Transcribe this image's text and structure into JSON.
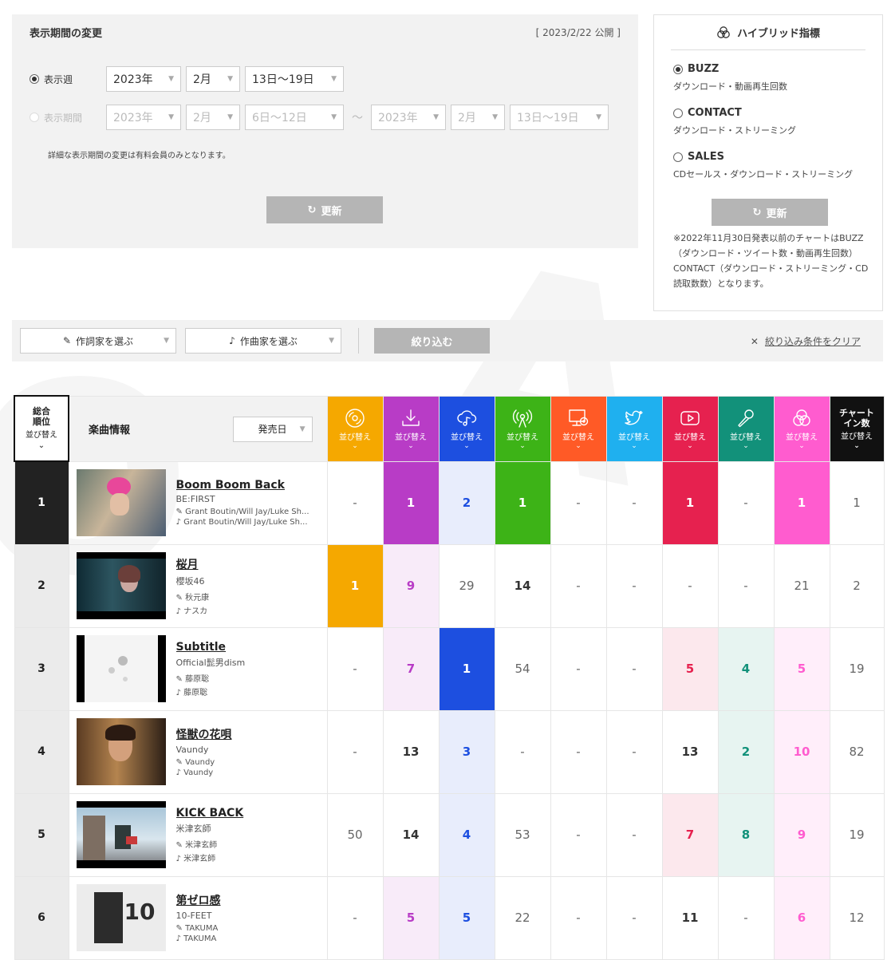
{
  "period": {
    "title": "表示期間の変更",
    "published": "[ 2023/2/22 公開 ]",
    "week_label": "表示週",
    "week": {
      "year": "2023年",
      "month": "2月",
      "days": "13日〜19日"
    },
    "range_label": "表示期間",
    "range_from": {
      "year": "2023年",
      "month": "2月",
      "days": "6日〜12日"
    },
    "range_sep": "〜",
    "range_to": {
      "year": "2023年",
      "month": "2月",
      "days": "13日〜19日"
    },
    "note": "詳細な表示期間の変更は有料会員のみとなります。",
    "update": "更新"
  },
  "hybrid": {
    "title": "ハイブリッド指標",
    "options": [
      {
        "name": "BUZZ",
        "desc": "ダウンロード・動画再生回数",
        "selected": true
      },
      {
        "name": "CONTACT",
        "desc": "ダウンロード・ストリーミング",
        "selected": false
      },
      {
        "name": "SALES",
        "desc": "CDセールス・ダウンロード・ストリーミング",
        "selected": false
      }
    ],
    "update": "更新",
    "note": "※2022年11月30日発表以前のチャートはBUZZ（ダウンロード・ツイート数・動画再生回数）CONTACT（ダウンロード・ストリーミング・CD読取数数）となります。"
  },
  "filter": {
    "lyricist": "作詞家を選ぶ",
    "composer": "作曲家を選ぶ",
    "apply": "絞り込む",
    "clear": "絞り込み条件をクリア"
  },
  "table": {
    "rank_header": [
      "総合",
      "順位"
    ],
    "sort": "並び替え",
    "song_header": "楽曲情報",
    "date_select": "発売日",
    "chart_in_header": [
      "チャート",
      "イン数"
    ],
    "metric_columns": [
      {
        "icon": "cd-icon",
        "color": "#f5a800"
      },
      {
        "icon": "download-icon",
        "color": "#b83cc6"
      },
      {
        "icon": "streaming-icon",
        "color": "#1d4fe0"
      },
      {
        "icon": "radio-icon",
        "color": "#3db317"
      },
      {
        "icon": "pc-read-icon",
        "color": "#ff5a26"
      },
      {
        "icon": "twitter-icon",
        "color": "#1fb0ef"
      },
      {
        "icon": "youtube-icon",
        "color": "#e6214f"
      },
      {
        "icon": "karaoke-icon",
        "color": "#12917a"
      },
      {
        "icon": "hybrid-icon",
        "color": "#ff5ccf"
      }
    ],
    "rows": [
      {
        "rank": "1",
        "title": "Boom Boom Back",
        "artist": "BE:FIRST",
        "lyricist": "Grant Boutin/Will Jay/Luke Sh...",
        "composer": "Grant Boutin/Will Jay/Luke Sh...",
        "values": [
          "-",
          "1",
          "2",
          "1",
          "-",
          "-",
          "1",
          "-",
          "1"
        ],
        "chart_in": "1"
      },
      {
        "rank": "2",
        "title": "桜月",
        "artist": "櫻坂46",
        "lyricist": "秋元康",
        "composer": "ナスカ",
        "values": [
          "1",
          "9",
          "29",
          "14",
          "-",
          "-",
          "-",
          "-",
          "21"
        ],
        "chart_in": "2"
      },
      {
        "rank": "3",
        "title": "Subtitle",
        "artist": "Official髭男dism",
        "lyricist": "藤原聡",
        "composer": "藤原聡",
        "values": [
          "-",
          "7",
          "1",
          "54",
          "-",
          "-",
          "5",
          "4",
          "5"
        ],
        "chart_in": "19"
      },
      {
        "rank": "4",
        "title": "怪獣の花唄",
        "artist": "Vaundy",
        "lyricist": "Vaundy",
        "composer": "Vaundy",
        "values": [
          "-",
          "13",
          "3",
          "-",
          "-",
          "-",
          "13",
          "2",
          "10"
        ],
        "chart_in": "82"
      },
      {
        "rank": "5",
        "title": "KICK BACK",
        "artist": "米津玄師",
        "lyricist": "米津玄師",
        "composer": "米津玄師",
        "values": [
          "50",
          "14",
          "4",
          "53",
          "-",
          "-",
          "7",
          "8",
          "9"
        ],
        "chart_in": "19"
      },
      {
        "rank": "6",
        "title": "第ゼロ感",
        "artist": "10-FEET",
        "lyricist": "TAKUMA",
        "composer": "TAKUMA",
        "values": [
          "-",
          "5",
          "5",
          "22",
          "-",
          "-",
          "11",
          "-",
          "6"
        ],
        "chart_in": "12"
      }
    ]
  }
}
